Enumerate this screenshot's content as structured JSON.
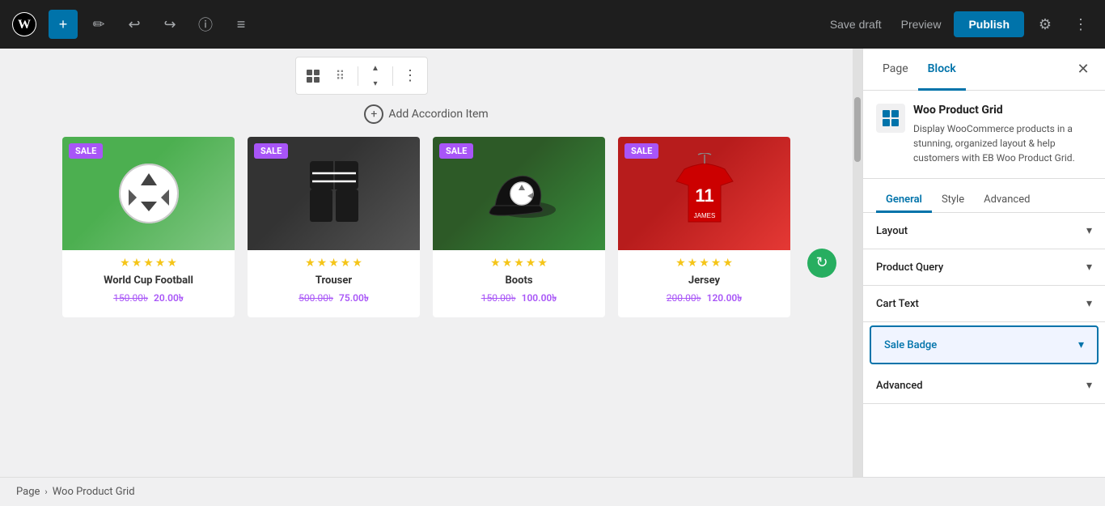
{
  "topbar": {
    "add_label": "+",
    "save_draft_label": "Save draft",
    "preview_label": "Preview",
    "publish_label": "Publish"
  },
  "breadcrumb": {
    "page_label": "Page",
    "separator": "›",
    "current_label": "Woo Product Grid"
  },
  "editor": {
    "add_accordion_text": "Add Accordion Item",
    "products": [
      {
        "name": "World Cup Football",
        "sale": true,
        "badge": "SALE",
        "old_price": "150.00৳",
        "new_price": "20.00৳",
        "stars": [
          1,
          1,
          1,
          1,
          1
        ],
        "img_type": "football"
      },
      {
        "name": "Trouser",
        "sale": true,
        "badge": "SALE",
        "old_price": "500.00৳",
        "new_price": "75.00৳",
        "stars": [
          1,
          1,
          1,
          1,
          1
        ],
        "img_type": "trouser"
      },
      {
        "name": "Boots",
        "sale": true,
        "badge": "SALE",
        "old_price": "150.00৳",
        "new_price": "100.00৳",
        "stars": [
          1,
          1,
          1,
          1,
          1
        ],
        "img_type": "boots"
      },
      {
        "name": "Jersey",
        "sale": true,
        "badge": "SALE",
        "old_price": "200.00৳",
        "new_price": "120.00৳",
        "stars": [
          1,
          1,
          1,
          1,
          1
        ],
        "img_type": "jersey"
      }
    ]
  },
  "right_panel": {
    "tab_page": "Page",
    "tab_block": "Block",
    "block_title": "Woo Product Grid",
    "block_desc": "Display WooCommerce products in a stunning, organized layout & help customers with EB Woo Product Grid.",
    "inner_tabs": [
      "General",
      "Style",
      "Advanced"
    ],
    "accordion_items": [
      {
        "label": "Layout",
        "active": false
      },
      {
        "label": "Product Query",
        "active": false
      },
      {
        "label": "Cart Text",
        "active": false
      },
      {
        "label": "Sale Badge",
        "active": true
      },
      {
        "label": "Advanced",
        "active": false
      }
    ]
  },
  "icons": {
    "add": "+",
    "pencil": "✏",
    "undo": "↩",
    "redo": "↪",
    "info": "ⓘ",
    "list": "≡",
    "grid": "⊞",
    "dots_drag": "⠿",
    "chevron_up": "▲",
    "chevron_down": "▾",
    "more_vert": "⋮",
    "close": "✕",
    "gear": "⚙",
    "chevron_right": "›",
    "block_icon": "⊞",
    "refresh": "↻"
  }
}
